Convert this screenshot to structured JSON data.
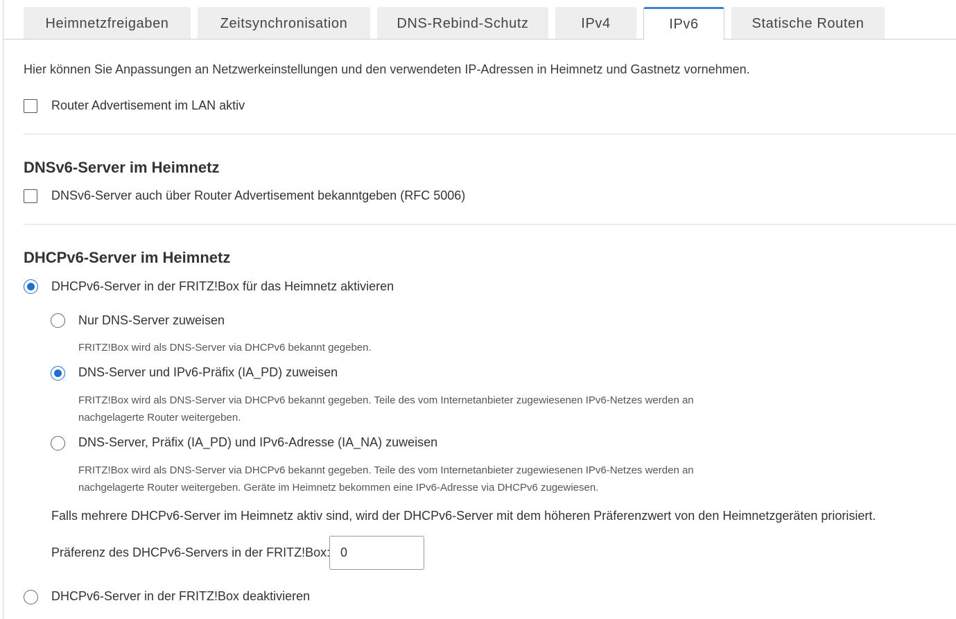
{
  "tabs": [
    {
      "label": "Heimnetzfreigaben"
    },
    {
      "label": "Zeitsynchronisation"
    },
    {
      "label": "DNS-Rebind-Schutz"
    },
    {
      "label": "IPv4"
    },
    {
      "label": "IPv6",
      "active": true
    },
    {
      "label": "Statische Routen"
    }
  ],
  "intro": "Hier können Sie Anpassungen an Netzwerkeinstellungen und den verwendeten IP-Adressen in Heimnetz und Gastnetz vornehmen.",
  "router_advertisement": {
    "label": "Router Advertisement im LAN aktiv",
    "checked": false
  },
  "dns_section": {
    "heading": "DNSv6-Server im Heimnetz",
    "checkbox_label": "DNSv6-Server auch über Router Advertisement bekanntgeben (RFC 5006)",
    "checked": false
  },
  "dhcp_section": {
    "heading": "DHCPv6-Server im Heimnetz",
    "activate_label": "DHCPv6-Server in der FRITZ!Box für das Heimnetz aktivieren",
    "activate_checked": true,
    "options": [
      {
        "label": "Nur DNS-Server zuweisen",
        "checked": false,
        "hint": "FRITZ!Box wird als DNS-Server via DHCPv6 bekannt gegeben."
      },
      {
        "label": "DNS-Server und IPv6-Präfix (IA_PD) zuweisen",
        "checked": true,
        "hint": "FRITZ!Box wird als DNS-Server via DHCPv6 bekannt gegeben. Teile des vom Internetanbieter zugewiesenen IPv6-Netzes werden an nachgelagerte Router weitergeben."
      },
      {
        "label": "DNS-Server, Präfix (IA_PD) und IPv6-Adresse (IA_NA) zuweisen",
        "checked": false,
        "hint": "FRITZ!Box wird als DNS-Server via DHCPv6 bekannt gegeben. Teile des vom Internetanbieter zugewiesenen IPv6-Netzes werden an nachgelagerte Router weitergeben. Geräte im Heimnetz bekommen eine IPv6-Adresse via DHCPv6 zugewiesen."
      }
    ],
    "priority_note": "Falls mehrere DHCPv6-Server im Heimnetz aktiv sind, wird der DHCPv6-Server mit dem höheren Präferenzwert von den Heimnetzgeräten priorisiert.",
    "preference_label": "Präferenz des DHCPv6-Servers in der FRITZ!Box:",
    "preference_value": "0",
    "deactivate_label": "DHCPv6-Server in der FRITZ!Box deaktivieren",
    "deactivate_checked": false
  },
  "colors": {
    "accent": "#1f6fd0",
    "tab_bg": "#eeeeee",
    "active_tab_border": "#3f82d2"
  }
}
